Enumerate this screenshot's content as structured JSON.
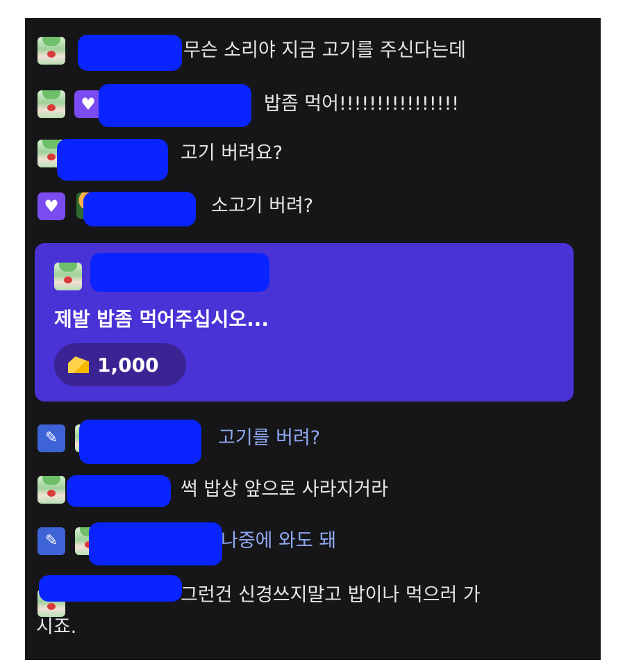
{
  "chat": {
    "messages": [
      {
        "text": "무슨 소리야 지금 고기를 주신다는데"
      },
      {
        "text": "밥좀 먹어!!!!!!!!!!!!!!!!"
      },
      {
        "text": "고기 버려요?"
      },
      {
        "text": "소고기 버려?"
      },
      {
        "text": "고기를 버려?"
      },
      {
        "text": "썩 밥상 앞으로 사라지거라"
      },
      {
        "text": "나중에 와도 돼"
      },
      {
        "text": "그런건 신경쓰지말고 밥이나 먹으러 가",
        "continuation": "시죠."
      }
    ],
    "donation": {
      "message": "제발 밥좀 먹어주십시오...",
      "amount": "1,000",
      "icon": "cheese-icon",
      "card_color": "#4a33d6"
    },
    "badges": {
      "subscriber_icon": "heart-icon",
      "manager_icon": "pen-icon"
    },
    "colors": {
      "panel_bg": "#161618",
      "text": "#e6e6e8",
      "highlight_text": "#8fa8f2"
    }
  }
}
